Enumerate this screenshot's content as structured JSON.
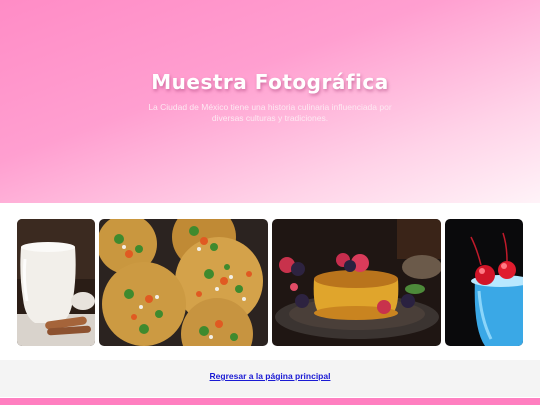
{
  "hero": {
    "title": "Muestra Fotográfica",
    "description": "La Ciudad de México tiene una historia culinaria influenciada por diversas culturas y tradiciones."
  },
  "gallery": {
    "photos": [
      {
        "icon": "horchata-drink-photo"
      },
      {
        "icon": "tacos-photo"
      },
      {
        "icon": "flan-dessert-photo"
      },
      {
        "icon": "blue-cocktail-photo"
      }
    ]
  },
  "footer": {
    "back_link": "Regresar a la página principal"
  },
  "colors": {
    "hero_gradient_start": "#ff8cc6",
    "hero_gradient_end": "#fff3f8",
    "link": "#1a1ad4",
    "bottom_bar": "#ff7fc0"
  }
}
